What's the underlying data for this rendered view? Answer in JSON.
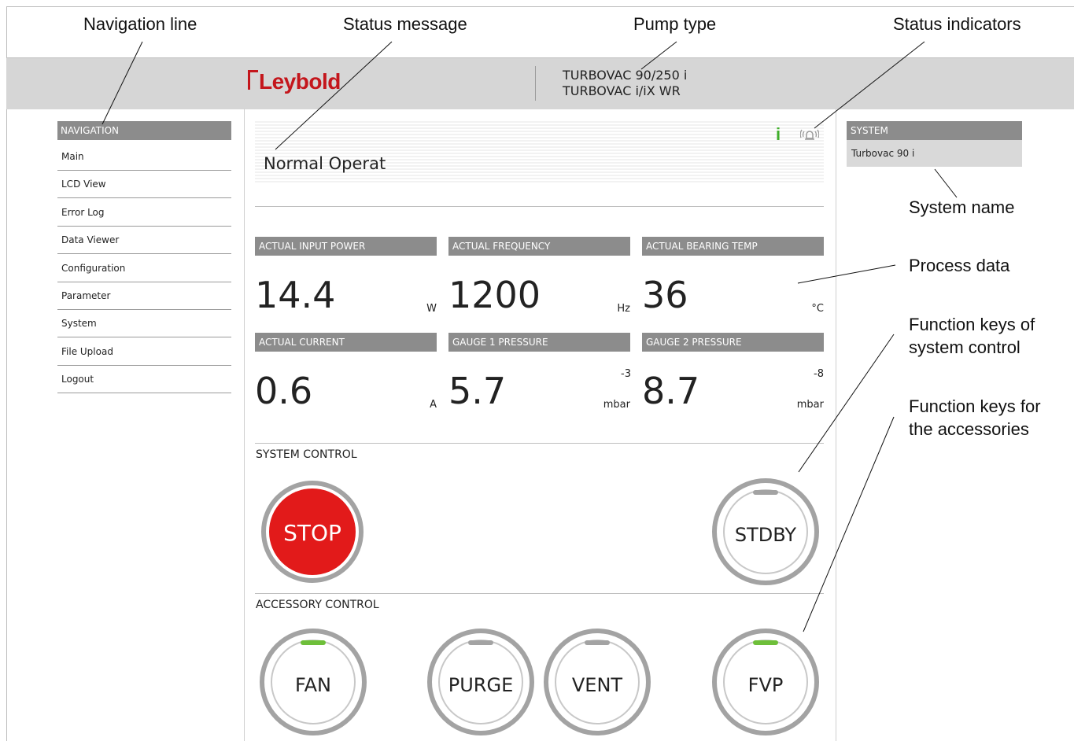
{
  "annotations": {
    "navigation_line": "Navigation line",
    "status_message": "Status message",
    "pump_type": "Pump type",
    "status_indicators": "Status indicators",
    "system_name": "System name",
    "process_data": "Process data",
    "function_keys_system_1": "Function keys of",
    "function_keys_system_2": "system control",
    "function_keys_accessories_1": "Function keys for",
    "function_keys_accessories_2": "the accessories"
  },
  "header": {
    "logo": "Leybold",
    "pump_line1": "TURBOVAC 90/250 i",
    "pump_line2": "TURBOVAC i/iX WR"
  },
  "navigation": {
    "title": "NAVIGATION",
    "items": [
      "Main",
      "LCD View",
      "Error Log",
      "Data Viewer",
      "Configuration",
      "Parameter",
      "System",
      "File Upload",
      "Logout"
    ]
  },
  "status": {
    "message": "Normal Operat",
    "info_icon": "i",
    "info_color": "#3fae2a",
    "alarm_icon": "alarm-bell-icon"
  },
  "process_data": [
    {
      "label": "ACTUAL INPUT POWER",
      "value": "14.4",
      "unit": "W",
      "exponent": ""
    },
    {
      "label": "ACTUAL FREQUENCY",
      "value": "1200",
      "unit": "Hz",
      "exponent": ""
    },
    {
      "label": "ACTUAL BEARING TEMP",
      "value": "36",
      "unit": "°C",
      "exponent": ""
    },
    {
      "label": "ACTUAL CURRENT",
      "value": "0.6",
      "unit": "A",
      "exponent": ""
    },
    {
      "label": "GAUGE 1 PRESSURE",
      "value": "5.7",
      "unit": "mbar",
      "exponent": "-3"
    },
    {
      "label": "GAUGE 2 PRESSURE",
      "value": "8.7",
      "unit": "mbar",
      "exponent": "-8"
    }
  ],
  "system_control": {
    "title": "SYSTEM CONTROL",
    "stop_label": "STOP",
    "stop_color": "#e21a1a",
    "standby_label": "STDBY"
  },
  "accessory_control": {
    "title": "ACCESSORY CONTROL",
    "fan_label": "FAN",
    "purge_label": "PURGE",
    "vent_label": "VENT",
    "fvp_label": "FVP",
    "active_color": "#6ebf3a",
    "inactive_color": "#a3a3a3"
  },
  "system_panel": {
    "title": "SYSTEM",
    "name": "Turbovac 90 i"
  }
}
